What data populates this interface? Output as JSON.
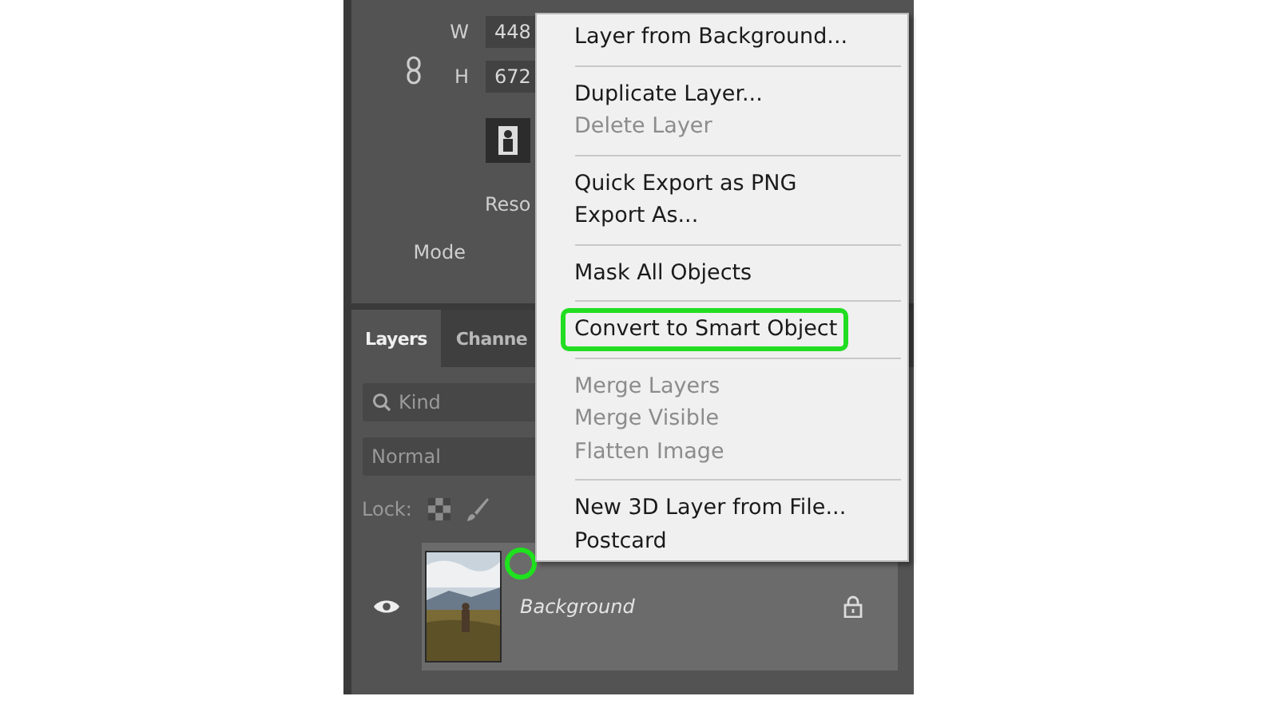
{
  "properties": {
    "width_label": "W",
    "width_value": "448",
    "height_label": "H",
    "height_value": "672",
    "resolution_label": "Reso",
    "mode_label": "Mode"
  },
  "layers_panel": {
    "tabs": [
      {
        "label": "Layers",
        "selected": true
      },
      {
        "label": "Channe",
        "selected": false
      }
    ],
    "filter": {
      "value": "Kind"
    },
    "blend_mode": {
      "value": "Normal"
    },
    "lock_label": "Lock:",
    "layers": [
      {
        "name": "Background",
        "visible": true,
        "selected": true,
        "locked": true,
        "annotated": true
      }
    ]
  },
  "context_menu": {
    "items": [
      {
        "kind": "item",
        "label": "Layer from Background...",
        "disabled": false,
        "highlighted": false
      },
      {
        "kind": "separator"
      },
      {
        "kind": "item",
        "label": "Duplicate Layer...",
        "disabled": false,
        "highlighted": false
      },
      {
        "kind": "item",
        "label": "Delete Layer",
        "disabled": true,
        "highlighted": false
      },
      {
        "kind": "separator"
      },
      {
        "kind": "item",
        "label": "Quick Export as PNG",
        "disabled": false,
        "highlighted": false
      },
      {
        "kind": "item",
        "label": "Export As...",
        "disabled": false,
        "highlighted": false
      },
      {
        "kind": "separator"
      },
      {
        "kind": "item",
        "label": "Mask All Objects",
        "disabled": false,
        "highlighted": false
      },
      {
        "kind": "separator"
      },
      {
        "kind": "item",
        "label": "Convert to Smart Object",
        "disabled": false,
        "highlighted": true
      },
      {
        "kind": "separator"
      },
      {
        "kind": "item",
        "label": "Merge Layers",
        "disabled": true,
        "highlighted": false
      },
      {
        "kind": "item",
        "label": "Merge Visible",
        "disabled": true,
        "highlighted": false
      },
      {
        "kind": "item",
        "label": "Flatten Image",
        "disabled": true,
        "highlighted": false
      },
      {
        "kind": "separator"
      },
      {
        "kind": "item",
        "label": "New 3D Layer from File...",
        "disabled": false,
        "highlighted": false
      },
      {
        "kind": "item",
        "label": "Postcard",
        "disabled": false,
        "highlighted": false
      }
    ]
  }
}
